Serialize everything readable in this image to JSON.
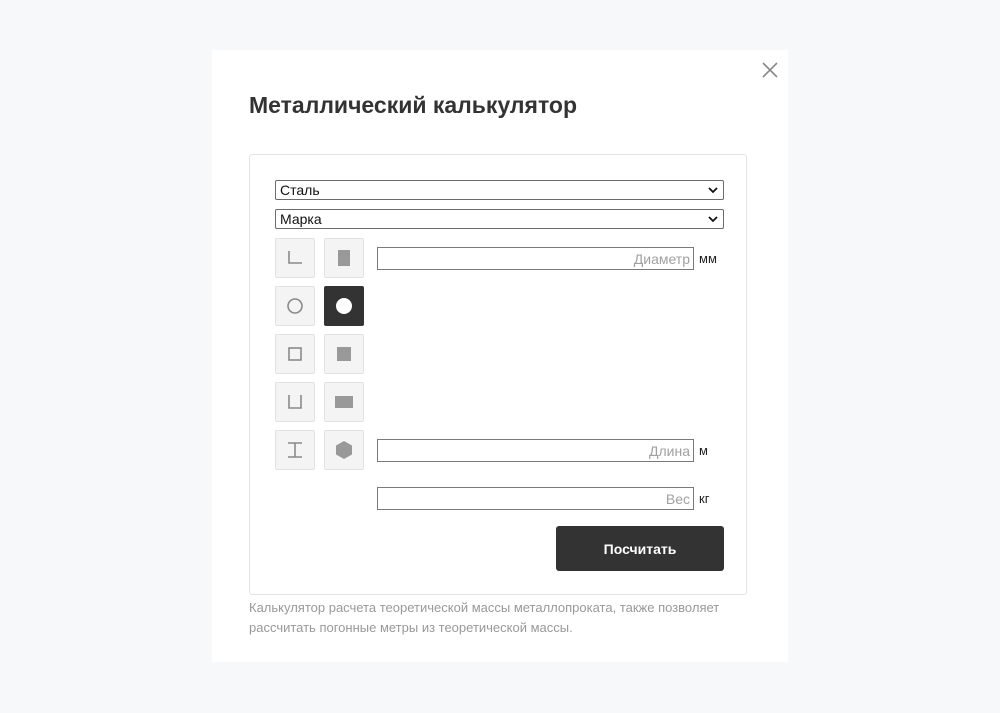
{
  "modal": {
    "title": "Металлический калькулятор",
    "description": "Калькулятор расчета теоретической массы металлопроката, также позволяет рассчитать погонные метры из теоретической массы."
  },
  "form": {
    "material_select": {
      "value": "Сталь"
    },
    "grade_select": {
      "value": "Марка"
    },
    "shapes": [
      {
        "name": "angle-icon",
        "active": false
      },
      {
        "name": "sheet-icon",
        "active": false
      },
      {
        "name": "pipe-round-icon",
        "active": false
      },
      {
        "name": "round-bar-icon",
        "active": true
      },
      {
        "name": "pipe-square-icon",
        "active": false
      },
      {
        "name": "square-bar-icon",
        "active": false
      },
      {
        "name": "channel-icon",
        "active": false
      },
      {
        "name": "strip-icon",
        "active": false
      },
      {
        "name": "i-beam-icon",
        "active": false
      },
      {
        "name": "hexagon-bar-icon",
        "active": false
      }
    ],
    "diameter": {
      "placeholder": "Диаметр",
      "unit": "мм"
    },
    "length": {
      "placeholder": "Длина",
      "unit": "м"
    },
    "weight": {
      "placeholder": "Вес",
      "unit": "кг"
    },
    "submit_label": "Посчитать"
  },
  "colors": {
    "accent": "#333333",
    "page_background": "#f7f8fa",
    "icon_gray": "#999999",
    "muted_text": "#999999"
  }
}
